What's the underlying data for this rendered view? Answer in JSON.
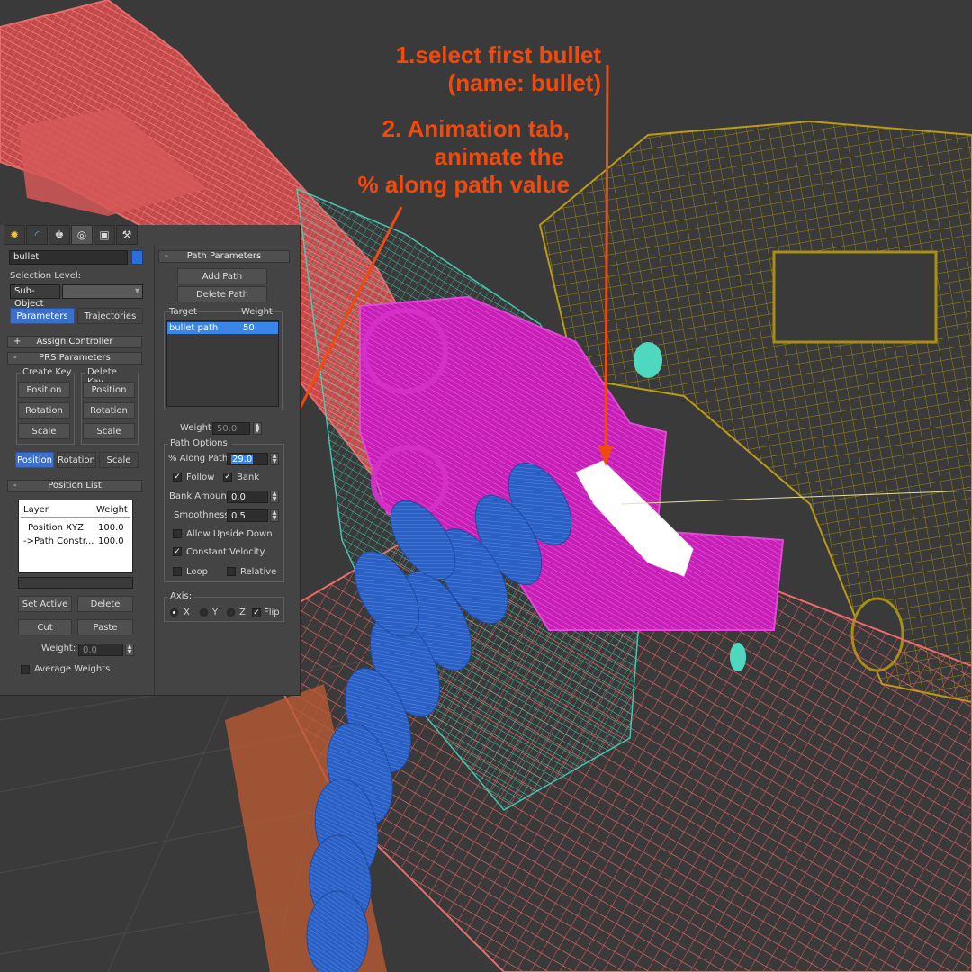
{
  "annotations": {
    "step1_line1": "1.select first bullet",
    "step1_line2": "(name: bullet)",
    "step2_line1": "2. Animation tab,",
    "step2_line2": "animate the",
    "step2_line3": "% along path value",
    "color": "#f04a0e"
  },
  "command_panel": {
    "tabs": [
      "create-icon",
      "modify-icon",
      "hierarchy-icon",
      "motion-icon",
      "display-icon",
      "utilities-icon"
    ],
    "tab_glyphs": [
      "✹",
      "◜",
      "♚",
      "◎",
      "▣",
      "⚒"
    ],
    "object_name": "bullet",
    "object_color": "#2a6fe0",
    "selection_level_label": "Selection Level:",
    "sub_object_label": "Sub-Object",
    "parameters_label": "Parameters",
    "trajectories_label": "Trajectories",
    "assign_controller_label": "Assign Controller",
    "prs_parameters_label": "PRS Parameters",
    "create_key_label": "Create Key",
    "delete_key_label": "Delete Key",
    "position_label": "Position",
    "rotation_label": "Rotation",
    "scale_label": "Scale",
    "position_list_label": "Position List",
    "layer_header": "Layer",
    "weight_header": "Weight",
    "layers": [
      {
        "name": "Position XYZ",
        "weight": "100.0"
      },
      {
        "name": "->Path Constr...",
        "weight": "100.0"
      }
    ],
    "set_active_label": "Set Active",
    "delete_label": "Delete",
    "cut_label": "Cut",
    "paste_label": "Paste",
    "weight_label": "Weight:",
    "weight_value": "0.0",
    "average_weights_label": "Average Weights"
  },
  "path_parameters": {
    "title": "Path Parameters",
    "add_path_label": "Add Path",
    "delete_path_label": "Delete Path",
    "target_header": "Target",
    "weight_header": "Weight",
    "targets": [
      {
        "name": "bullet path",
        "weight": "50"
      }
    ],
    "weight_label": "Weight",
    "weight_value": "50.0",
    "path_options_label": "Path Options:",
    "along_path_label": "% Along Path:",
    "along_path_value": "29.0",
    "follow_label": "Follow",
    "bank_label": "Bank",
    "bank_amount_label": "Bank Amount:",
    "bank_amount_value": "0.0",
    "smoothness_label": "Smoothness:",
    "smoothness_value": "0.5",
    "allow_upside_down_label": "Allow Upside Down",
    "constant_velocity_label": "Constant Velocity",
    "loop_label": "Loop",
    "relative_label": "Relative",
    "axis_label": "Axis:",
    "x_label": "X",
    "y_label": "Y",
    "z_label": "Z",
    "flip_label": "Flip",
    "follow_checked": true,
    "bank_checked": true,
    "constant_velocity_checked": true,
    "flip_checked": true,
    "axis_selected": "X"
  }
}
